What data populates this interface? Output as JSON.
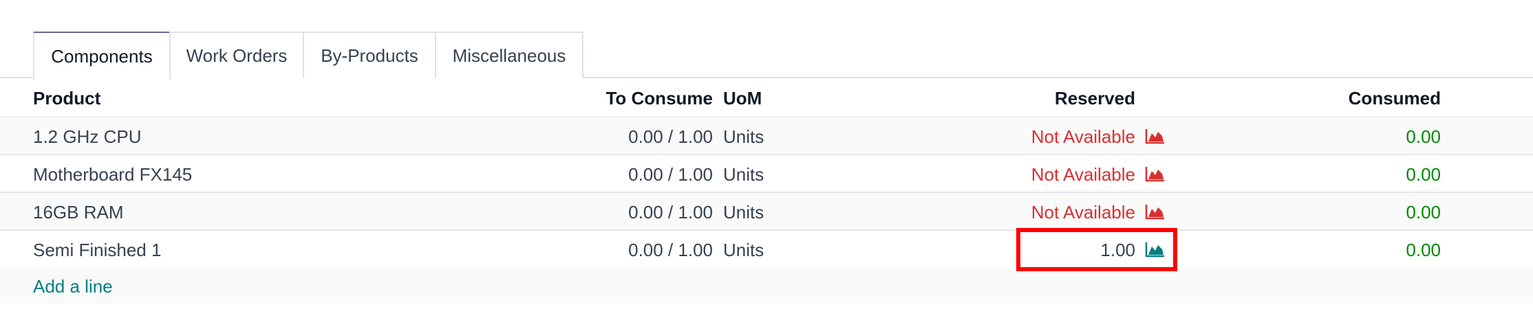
{
  "tabs": [
    {
      "label": "Components",
      "active": true
    },
    {
      "label": "Work Orders",
      "active": false
    },
    {
      "label": "By-Products",
      "active": false
    },
    {
      "label": "Miscellaneous",
      "active": false
    }
  ],
  "columns": {
    "product": "Product",
    "to_consume": "To Consume",
    "uom": "UoM",
    "reserved": "Reserved",
    "consumed": "Consumed"
  },
  "rows": [
    {
      "product": "1.2 GHz CPU",
      "to_consume": "0.00 / 1.00",
      "uom": "Units",
      "reserved": "Not Available",
      "reserved_status": "unavailable",
      "consumed": "0.00"
    },
    {
      "product": "Motherboard FX145",
      "to_consume": "0.00 / 1.00",
      "uom": "Units",
      "reserved": "Not Available",
      "reserved_status": "unavailable",
      "consumed": "0.00"
    },
    {
      "product": "16GB RAM",
      "to_consume": "0.00 / 1.00",
      "uom": "Units",
      "reserved": "Not Available",
      "reserved_status": "unavailable",
      "consumed": "0.00"
    },
    {
      "product": "Semi Finished 1",
      "to_consume": "0.00 / 1.00",
      "uom": "Units",
      "reserved": "1.00",
      "reserved_status": "available",
      "consumed": "0.00"
    }
  ],
  "add_line_label": "Add a line",
  "icons": {
    "forecast": "area-chart-icon"
  },
  "colors": {
    "not_available": "#d9302f",
    "consumed_green": "#008a00",
    "forecast_unavailable": "#d9302f",
    "forecast_available": "#017e84",
    "link": "#017e84",
    "highlight": "#ff0000"
  }
}
